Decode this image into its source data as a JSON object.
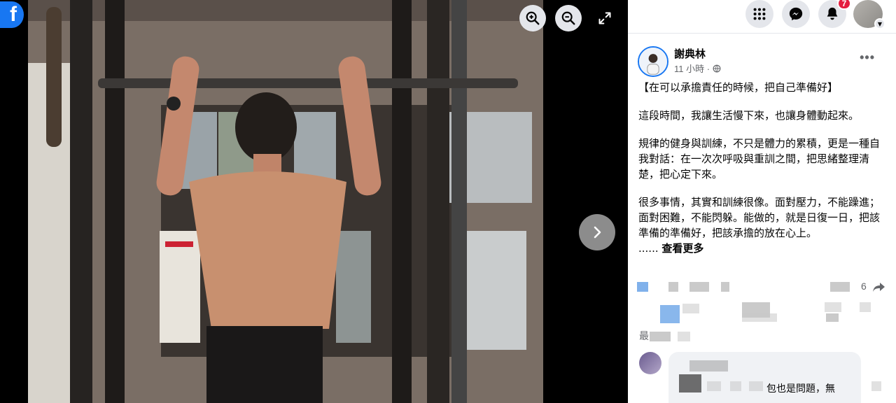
{
  "viewer": {
    "logo_letter": "f",
    "buttons": {
      "zoom_in": "zoom-in-icon",
      "zoom_out": "zoom-out-icon",
      "fullscreen": "fullscreen-icon",
      "next": "chevron-right-icon"
    }
  },
  "topbar": {
    "notification_count": "7"
  },
  "post": {
    "author": "謝典林",
    "time": "11 小時 ·",
    "title": "【在可以承擔責任的時候，把自己準備好】",
    "paragraphs": [
      "這段時間，我讓生活慢下來，也讓身體動起來。",
      "規律的健身與訓練，不只是體力的累積，更是一種自我對話：在一次次呼吸與重訓之間，把思緒整理清楚，把心定下來。",
      "很多事情，其實和訓練很像。面對壓力，不能躁進；面對困難，不能閃躲。能做的，就是日復一日，把該準備的準備好，把該承擔的放在心上。"
    ],
    "ellipsis": "......",
    "see_more": "查看更多"
  },
  "comments": {
    "partial_count": "6",
    "comment_label": "最",
    "partial_comment": "包也是問題，無"
  }
}
